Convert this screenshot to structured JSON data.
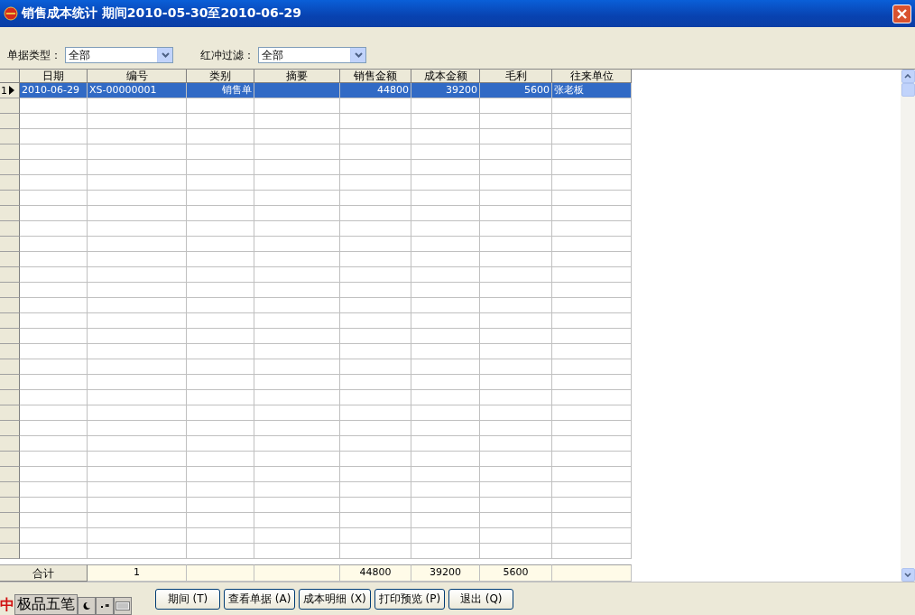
{
  "window": {
    "title": "销售成本统计  期间2010-05-30至2010-06-29"
  },
  "filters": [
    {
      "label": "单据类型：",
      "value": "全部"
    },
    {
      "label": "红冲过滤：",
      "value": "全部"
    }
  ],
  "table": {
    "columns": [
      "日期",
      "编号",
      "类别",
      "摘要",
      "销售金额",
      "成本金额",
      "毛利",
      "往来单位"
    ],
    "rows": [
      {
        "row_number": "1",
        "selected": true,
        "date": "2010-06-29",
        "number": "XS-00000001",
        "type": "销售单",
        "sales": "44800",
        "cost": "39200",
        "profit": "5600",
        "partner": "张老板"
      }
    ],
    "totals": {
      "label": "合计",
      "number": "1",
      "sales": "44800",
      "cost": "39200",
      "profit": "5600"
    }
  },
  "ime_bar": {
    "mode": "中",
    "name": "极品五笔"
  },
  "buttons": [
    "期间 (T)",
    "查看单据 (A)",
    "成本明细 (X)",
    "打印预览 (P)",
    "退出 (Q)"
  ]
}
